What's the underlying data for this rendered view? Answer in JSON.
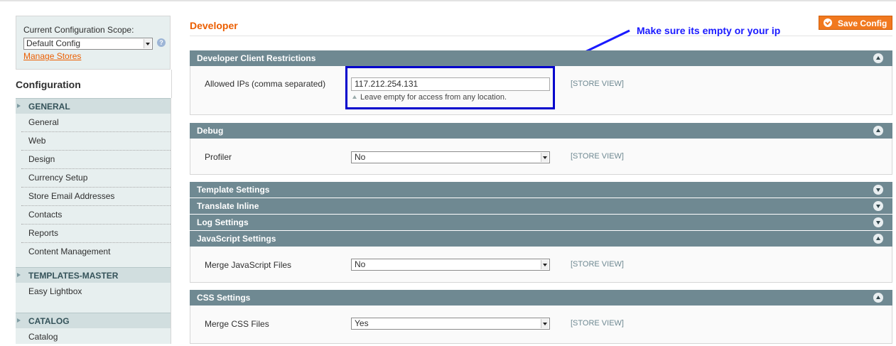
{
  "scope": {
    "label": "Current Configuration Scope:",
    "selected": "Default Config",
    "manage_stores": "Manage Stores"
  },
  "sidebar": {
    "title": "Configuration",
    "groups": [
      {
        "label": "GENERAL",
        "items": [
          "General",
          "Web",
          "Design",
          "Currency Setup",
          "Store Email Addresses",
          "Contacts",
          "Reports",
          "Content Management"
        ]
      },
      {
        "label": "TEMPLATES-MASTER",
        "items": [
          "Easy Lightbox"
        ]
      },
      {
        "label": "CATALOG",
        "items": [
          "Catalog"
        ]
      }
    ]
  },
  "main": {
    "title": "Developer",
    "save_button": "Save Config",
    "annotation": "Make sure its empty or your ip",
    "sections": [
      {
        "title": "Developer Client Restrictions",
        "expanded": true,
        "field": {
          "label": "Allowed IPs (comma separated)",
          "value": "117.212.254.131",
          "note": "Leave empty for access from any location.",
          "scope": "[STORE VIEW]"
        }
      },
      {
        "title": "Debug",
        "expanded": true,
        "field": {
          "label": "Profiler",
          "value": "No",
          "scope": "[STORE VIEW]"
        }
      },
      {
        "title": "Template Settings",
        "expanded": false
      },
      {
        "title": "Translate Inline",
        "expanded": false
      },
      {
        "title": "Log Settings",
        "expanded": false
      },
      {
        "title": "JavaScript Settings",
        "expanded": true,
        "field": {
          "label": "Merge JavaScript Files",
          "value": "No",
          "scope": "[STORE VIEW]"
        }
      },
      {
        "title": "CSS Settings",
        "expanded": true,
        "field": {
          "label": "Merge CSS Files",
          "value": "Yes",
          "scope": "[STORE VIEW]"
        }
      }
    ]
  },
  "colors": {
    "accent": "#eb5e00",
    "section_header": "#6f8992",
    "annotation": "#1a1aff"
  }
}
